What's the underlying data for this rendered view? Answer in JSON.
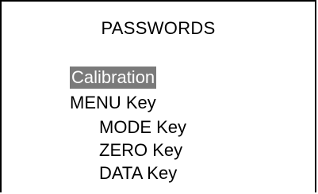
{
  "screen": {
    "title": "PASSWORDS",
    "menu_items": [
      {
        "label": "Calibration",
        "selected": true,
        "level": 1
      },
      {
        "label": "MENU Key",
        "selected": false,
        "level": 1
      },
      {
        "label": "MODE Key",
        "selected": false,
        "level": 2
      },
      {
        "label": "ZERO Key",
        "selected": false,
        "level": 2
      },
      {
        "label": "DATA Key",
        "selected": false,
        "level": 2
      }
    ]
  },
  "colors": {
    "background": "#ffffff",
    "text": "#000000",
    "selection_highlight": "#7a7a7a",
    "selection_text": "#ffffff",
    "frame": "#000000"
  }
}
